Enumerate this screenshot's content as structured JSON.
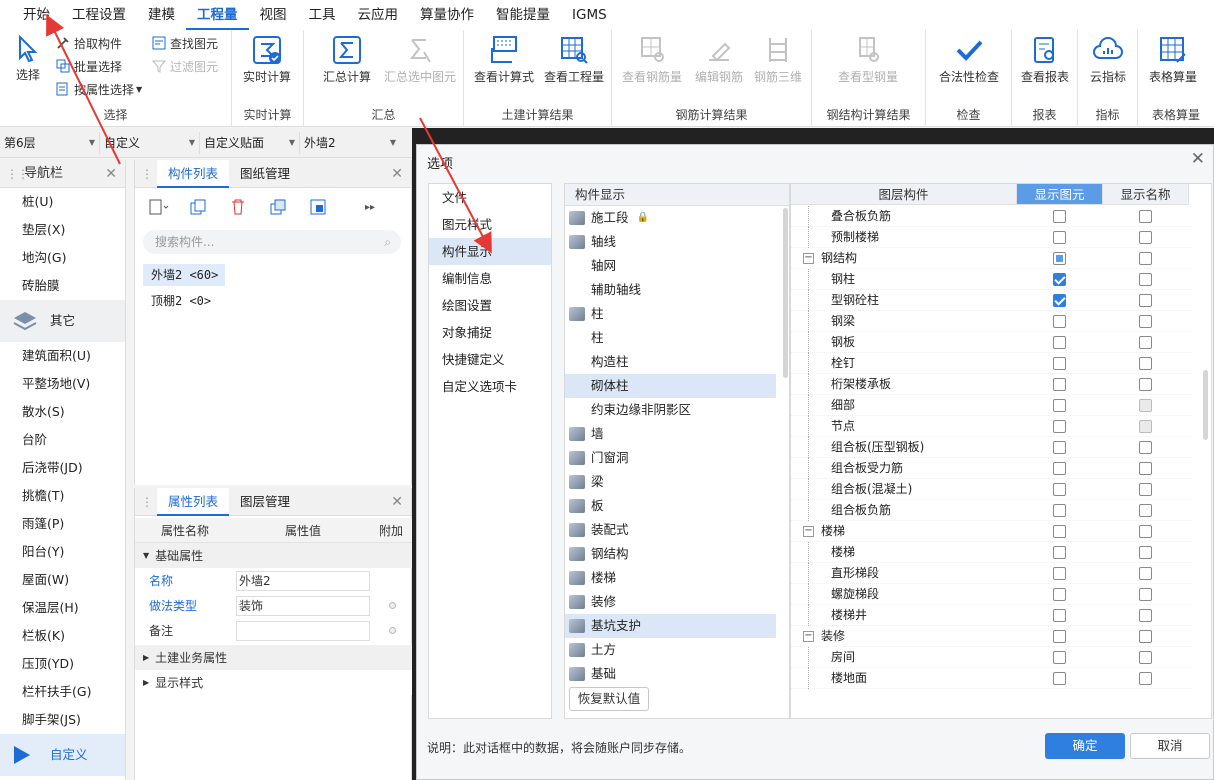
{
  "menu": [
    "开始",
    "工程设置",
    "建模",
    "工程量",
    "视图",
    "工具",
    "云应用",
    "算量协作",
    "智能提量",
    "IGMS"
  ],
  "menu_active": "工程量",
  "ribbon": {
    "select": {
      "big": "选择",
      "pick": "拾取构件",
      "batch": "批量选择",
      "byattr": "按属性选择",
      "find": "查找图元",
      "filter": "过滤图元",
      "group": "选择"
    },
    "realtime": {
      "btn": "实时计算",
      "group": "实时计算"
    },
    "summary": {
      "calc": "汇总计算",
      "calc_sel": "汇总选中图元",
      "group": "汇总"
    },
    "civil": {
      "formula": "查看计算式",
      "quantity": "查看工程量",
      "group": "土建计算结果"
    },
    "rebar": {
      "view": "查看钢筋量",
      "edit": "编辑钢筋",
      "three_d": "钢筋三维",
      "group": "钢筋计算结果"
    },
    "steel": {
      "view": "查看型钢量",
      "group": "钢结构计算结果"
    },
    "check": {
      "btn": "合法性检查",
      "group": "检查"
    },
    "report": {
      "btn": "查看报表",
      "group": "报表"
    },
    "index": {
      "btn": "云指标",
      "group": "指标"
    },
    "table": {
      "btn": "表格算量",
      "group": "表格算量"
    }
  },
  "toolbar2": {
    "floor": "第6层",
    "def": "自定义",
    "paste": "自定义贴面",
    "wall": "外墙2"
  },
  "nav": {
    "title": "导航栏",
    "items_top": [
      "桩(U)",
      "垫层(X)",
      "地沟(G)",
      "砖胎膜"
    ],
    "section": "其它",
    "items": [
      "建筑面积(U)",
      "平整场地(V)",
      "散水(S)",
      "台阶",
      "后浇带(JD)",
      "挑檐(T)",
      "雨篷(P)",
      "阳台(Y)",
      "屋面(W)",
      "保温层(H)",
      "栏板(K)",
      "压顶(YD)",
      "栏杆扶手(G)",
      "脚手架(JS)"
    ],
    "bottom": "自定义"
  },
  "comp": {
    "tab1": "构件列表",
    "tab2": "图纸管理",
    "search": "搜索构件...",
    "items": [
      "外墙2 <60>",
      "顶棚2 <0>"
    ]
  },
  "props": {
    "tab1": "属性列表",
    "tab2": "图层管理",
    "h_name": "属性名称",
    "h_val": "属性值",
    "h_add": "附加",
    "grp_basic": "基础属性",
    "rows": [
      {
        "k": "名称",
        "v": "外墙2"
      },
      {
        "k": "做法类型",
        "v": "装饰"
      },
      {
        "k": "备注",
        "v": ""
      }
    ],
    "grp_civil": "土建业务属性",
    "grp_style": "显示样式"
  },
  "dialog": {
    "title": "选项",
    "nav": [
      "文件",
      "图元样式",
      "构件显示",
      "编制信息",
      "绘图设置",
      "对象捕捉",
      "快捷键定义",
      "自定义选项卡"
    ],
    "tree_header": "构件显示",
    "tree": [
      {
        "t": "施工段",
        "lvl": 1,
        "lock": "🔒"
      },
      {
        "t": "轴线",
        "lvl": 1
      },
      {
        "t": "轴网",
        "lvl": 2
      },
      {
        "t": "辅助轴线",
        "lvl": 2
      },
      {
        "t": "柱",
        "lvl": 1
      },
      {
        "t": "柱",
        "lvl": 2
      },
      {
        "t": "构造柱",
        "lvl": 2
      },
      {
        "t": "砌体柱",
        "lvl": 2,
        "sel": true
      },
      {
        "t": "约束边缘非阴影区",
        "lvl": 2
      },
      {
        "t": "墙",
        "lvl": 1
      },
      {
        "t": "门窗洞",
        "lvl": 1
      },
      {
        "t": "梁",
        "lvl": 1
      },
      {
        "t": "板",
        "lvl": 1
      },
      {
        "t": "装配式",
        "lvl": 1
      },
      {
        "t": "钢结构",
        "lvl": 1
      },
      {
        "t": "楼梯",
        "lvl": 1
      },
      {
        "t": "装修",
        "lvl": 1
      },
      {
        "t": "基坑支护",
        "lvl": 1,
        "sel": true
      },
      {
        "t": "土方",
        "lvl": 1
      },
      {
        "t": "基础",
        "lvl": 1
      }
    ],
    "restore": "恢复默认值",
    "layer_h1": "图层构件",
    "layer_h2": "显示图元",
    "layer_h3": "显示名称",
    "layers": [
      {
        "t": "叠合板负筋",
        "lvl": 2,
        "a": "off",
        "b": "off"
      },
      {
        "t": "预制楼梯",
        "lvl": 2,
        "a": "off",
        "b": "off"
      },
      {
        "t": "钢结构",
        "lvl": 1,
        "a": "part",
        "b": "off"
      },
      {
        "t": "钢柱",
        "lvl": 2,
        "a": "on",
        "b": "off"
      },
      {
        "t": "型钢砼柱",
        "lvl": 2,
        "a": "on",
        "b": "off"
      },
      {
        "t": "钢梁",
        "lvl": 2,
        "a": "off",
        "b": "off"
      },
      {
        "t": "钢板",
        "lvl": 2,
        "a": "off",
        "b": "off"
      },
      {
        "t": "栓钉",
        "lvl": 2,
        "a": "off",
        "b": "off"
      },
      {
        "t": "桁架楼承板",
        "lvl": 2,
        "a": "off",
        "b": "off"
      },
      {
        "t": "细部",
        "lvl": 2,
        "a": "off",
        "b": "gray"
      },
      {
        "t": "节点",
        "lvl": 2,
        "a": "off",
        "b": "gray"
      },
      {
        "t": "组合板(压型钢板)",
        "lvl": 2,
        "a": "off",
        "b": "off"
      },
      {
        "t": "组合板受力筋",
        "lvl": 2,
        "a": "off",
        "b": "off"
      },
      {
        "t": "组合板(混凝土)",
        "lvl": 2,
        "a": "off",
        "b": "off"
      },
      {
        "t": "组合板负筋",
        "lvl": 2,
        "a": "off",
        "b": "off"
      },
      {
        "t": "楼梯",
        "lvl": 1,
        "a": "off",
        "b": "off"
      },
      {
        "t": "楼梯",
        "lvl": 2,
        "a": "off",
        "b": "off"
      },
      {
        "t": "直形梯段",
        "lvl": 2,
        "a": "off",
        "b": "off"
      },
      {
        "t": "螺旋梯段",
        "lvl": 2,
        "a": "off",
        "b": "off"
      },
      {
        "t": "楼梯井",
        "lvl": 2,
        "a": "off",
        "b": "off"
      },
      {
        "t": "装修",
        "lvl": 1,
        "a": "off",
        "b": "off"
      },
      {
        "t": "房间",
        "lvl": 2,
        "a": "off",
        "b": "off"
      },
      {
        "t": "楼地面",
        "lvl": 2,
        "a": "off",
        "b": "off"
      }
    ],
    "note": "说明：此对话框中的数据，将会随账户同步存储。",
    "ok": "确定",
    "cancel": "取消"
  },
  "colors": {
    "accent": "#1c6bd6",
    "primary_btn": "#2f7fe0",
    "arrow": "#e53935"
  }
}
